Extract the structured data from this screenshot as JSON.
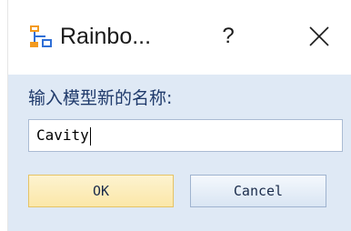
{
  "window": {
    "title": "Rainbo...",
    "help_label": "?",
    "icon": "network-nodes-icon",
    "close_icon": "close-icon"
  },
  "prompt": {
    "label": "输入模型新的名称:"
  },
  "input": {
    "value": "Cavity"
  },
  "buttons": {
    "ok_label": "OK",
    "cancel_label": "Cancel"
  },
  "colors": {
    "content_background": "#dfe9f5",
    "ok_border": "#e5c365",
    "ok_fill": "#fbe7a8",
    "cancel_border": "#9fb3cf",
    "icon_orange": "#f39a1e",
    "icon_blue": "#2f6fd6"
  }
}
